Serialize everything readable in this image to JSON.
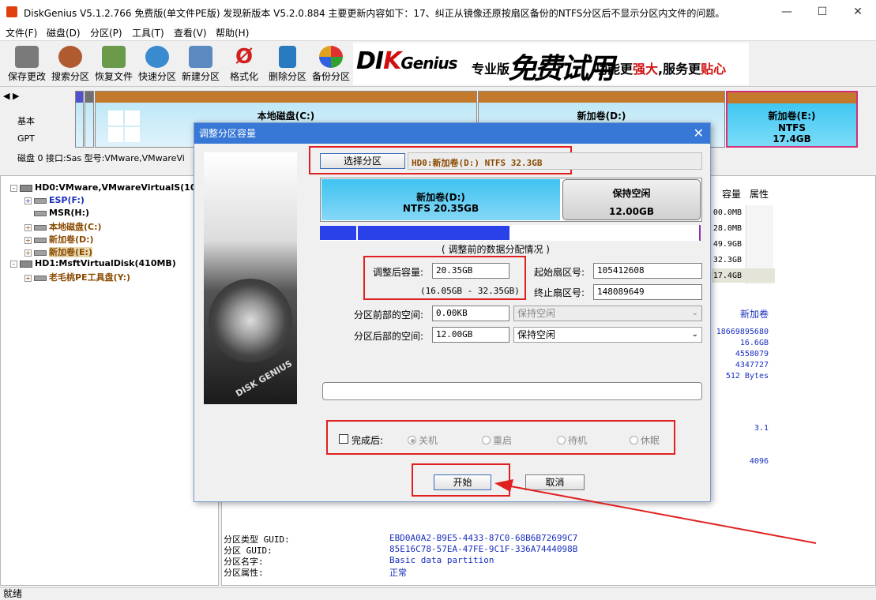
{
  "window": {
    "title": "DiskGenius V5.1.2.766 免费版(单文件PE版)   发现新版本 V5.2.0.884 主要更新内容如下：17、纠正从镜像还原按扇区备份的NTFS分区后不显示分区内文件的问题。",
    "minimize_icon": "minimize-icon",
    "maximize_icon": "maximize-icon",
    "close_icon": "close-icon"
  },
  "menu": [
    "文件(F)",
    "磁盘(D)",
    "分区(P)",
    "工具(T)",
    "查看(V)",
    "帮助(H)"
  ],
  "toolbar": [
    {
      "label": "保存更改",
      "icon": "save-icon",
      "color": "#6a6a6a"
    },
    {
      "label": "搜索分区",
      "icon": "search-partition-icon",
      "color": "#b05a30"
    },
    {
      "label": "恢复文件",
      "icon": "recover-files-icon",
      "color": "#5a8a3a"
    },
    {
      "label": "快速分区",
      "icon": "quick-partition-icon",
      "color": "#3a8ad0"
    },
    {
      "label": "新建分区",
      "icon": "new-partition-icon",
      "color": "#4a7ab0"
    },
    {
      "label": "格式化",
      "icon": "format-icon",
      "color": "#d02020"
    },
    {
      "label": "删除分区",
      "icon": "delete-partition-icon",
      "color": "#2a7ac0"
    },
    {
      "label": "备份分区",
      "icon": "backup-partition-icon",
      "color": "#d08020"
    }
  ],
  "banner": {
    "logo_pre": "DI",
    "logo_k": "K",
    "logo_post": "Genius",
    "edition": "专业版",
    "free_trial": "免费试用",
    "slogan_1": "功能更",
    "slogan_2": "强大",
    "slogan_3": ",服务更",
    "slogan_4": "贴心"
  },
  "diskmap": {
    "label_basic": "基本",
    "label_gpt": "GPT",
    "disk_info": "磁盘 0 接口:Sas  型号:VMware,VMwareVi",
    "partitions": [
      {
        "name": "本地磁盘(C:)"
      },
      {
        "name": "新加卷(D:)"
      },
      {
        "name": "新加卷(E:)",
        "fs": "NTFS",
        "size": "17.4GB"
      }
    ]
  },
  "tree": {
    "nodes": [
      {
        "text": "HD0:VMware,VMwareVirtualS(10",
        "color": "#000"
      },
      {
        "text": "ESP(F:)",
        "color": "#1a2fbf"
      },
      {
        "text": "MSR(H:)",
        "color": "#000"
      },
      {
        "text": "本地磁盘(C:)",
        "color": "#8a4a00"
      },
      {
        "text": "新加卷(D:)",
        "color": "#8a4a00"
      },
      {
        "text": "新加卷(E:)",
        "color": "#8a4a00"
      },
      {
        "text": "HD1:MsftVirtualDisk(410MB)",
        "color": "#000"
      },
      {
        "text": "老毛桃PE工具盘(Y:)",
        "color": "#8a4a00"
      }
    ]
  },
  "rightpanel": {
    "col_capacity": "容量",
    "col_attr": "属性",
    "capacities": [
      "00.0MB",
      "28.0MB",
      "49.9GB",
      "32.3GB",
      "17.4GB"
    ],
    "new_volume": "新加卷",
    "values": [
      "18669895680",
      "16.6GB",
      "4558079",
      "4347727",
      "512 Bytes"
    ],
    "ver": "3.1",
    "cluster": "4096",
    "guid_rows": [
      {
        "label": "分区类型 GUID:",
        "value": "EBD0A0A2-B9E5-4433-87C0-68B6B72699C7"
      },
      {
        "label": "分区 GUID:",
        "value": "85E16C78-57EA-47FE-9C1F-336A7444098B"
      },
      {
        "label": "分区名字:",
        "value": "Basic data partition"
      },
      {
        "label": "分区属性:",
        "value": "正常"
      }
    ]
  },
  "dialog": {
    "title": "调整分区容量",
    "select_button": "选择分区",
    "selected_partition": "HD0:新加卷(D:) NTFS 32.3GB",
    "bar_left_name": "新加卷(D:)",
    "bar_left_detail": "NTFS 20.35GB",
    "bar_right_name": "保持空闲",
    "bar_right_size": "12.00GB",
    "bar_used_fraction": 0.73,
    "bar_progress_fraction": 0.5,
    "caption": "( 调整前的数据分配情况 )",
    "new_size_label": "调整后容量:",
    "new_size_value": "20.35GB",
    "size_range": "(16.05GB - 32.35GB)",
    "start_sector_label": "起始扇区号:",
    "start_sector": "105412608",
    "end_sector_label": "终止扇区号:",
    "end_sector": "148089649",
    "before_label": "分区前部的空间:",
    "before_value": "0.00KB",
    "before_option": "保持空闲",
    "after_label": "分区后部的空间:",
    "after_value": "12.00GB",
    "after_option": "保持空闲",
    "after_done_label": "完成后:",
    "radios": [
      "关机",
      "重启",
      "待机",
      "休眠"
    ],
    "start_button": "开始",
    "cancel_button": "取消"
  },
  "status": "就绪"
}
